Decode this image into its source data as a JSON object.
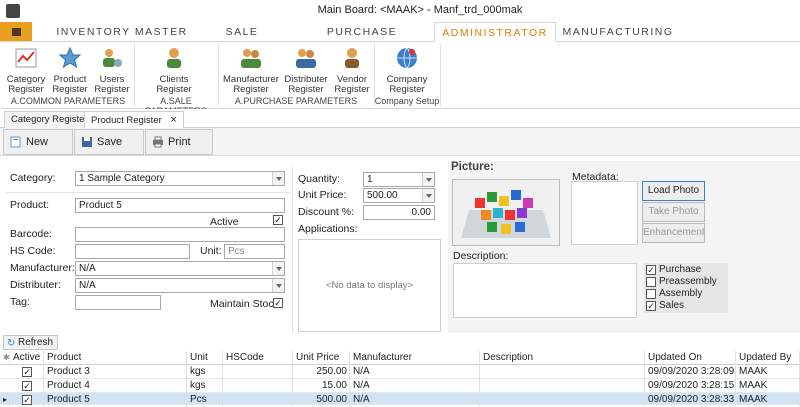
{
  "window": {
    "title": "Main Board: <MAAK> - Manf_trd_000mak"
  },
  "ribbon": {
    "tabs": [
      "INVENTORY MASTER",
      "SALE REGISTER",
      "PURCHASE REGISTER",
      "ADMINISTRATOR",
      "MANUFACTURING"
    ],
    "active_tab": "ADMINISTRATOR",
    "groups": [
      {
        "label": "A.COMMON PARAMETERS",
        "buttons": [
          {
            "line1": "Category",
            "line2": "Register",
            "icon": "chart-icon"
          },
          {
            "line1": "Product",
            "line2": "Register",
            "icon": "star-icon"
          },
          {
            "line1": "Users",
            "line2": "Register",
            "icon": "users-gear-icon"
          }
        ]
      },
      {
        "label": "A.SALE PARAMETERS",
        "buttons": [
          {
            "line1": "Clients",
            "line2": "Register",
            "icon": "person-icon"
          }
        ]
      },
      {
        "label": "A.PURCHASE PARAMETERS",
        "buttons": [
          {
            "line1": "Manufacturer",
            "line2": "Register",
            "icon": "people-icon"
          },
          {
            "line1": "Distributer",
            "line2": "Register",
            "icon": "people-icon"
          },
          {
            "line1": "Vendor",
            "line2": "Register",
            "icon": "person-icon"
          }
        ]
      },
      {
        "label": "Company Setup",
        "buttons": [
          {
            "line1": "Company",
            "line2": "Register",
            "icon": "globe-icon"
          }
        ]
      }
    ]
  },
  "doc_tabs": [
    {
      "label": "Category Register"
    },
    {
      "label": "Product Register",
      "close": "×"
    }
  ],
  "toolbar": {
    "new_label": "New",
    "save_label": "Save",
    "print_label": "Print"
  },
  "form": {
    "category_label": "Category:",
    "category_value": "1 Sample Category",
    "product_label": "Product:",
    "product_value": "Product 5",
    "active_label": "Active",
    "active_checked": "✓",
    "barcode_label": "Barcode:",
    "barcode_value": "",
    "hscode_label": "HS Code:",
    "hscode_value": "",
    "unit_label": "Unit:",
    "unit_placeholder": "Pcs",
    "manufacturer_label": "Manufacturer:",
    "manufacturer_value": "N/A",
    "distributer_label": "Distributer:",
    "distributer_value": "N/A",
    "tag_label": "Tag:",
    "tag_value": "",
    "maintain_stock_label": "Maintain Stock",
    "maintain_stock_checked": "✓",
    "quantity_label": "Quantity:",
    "quantity_value": "1",
    "unit_price_label": "Unit Price:",
    "unit_price_value": "500.00",
    "discount_label": "Discount %:",
    "discount_value": "0.00",
    "applications_label": "Applications:",
    "applications_empty": "<No data to display>",
    "picture_label": "Picture:",
    "metadata_label": "Metadata:",
    "description_label": "Description:",
    "load_photo": "Load Photo",
    "take_photo": "Take Photo",
    "enhancement": "Enhancement",
    "flags": [
      {
        "label": "Purchase",
        "checked": "✓"
      },
      {
        "label": "Preassembly",
        "checked": ""
      },
      {
        "label": "Assembly",
        "checked": ""
      },
      {
        "label": "Sales",
        "checked": "✓"
      }
    ]
  },
  "grid": {
    "refresh_label": "Refresh",
    "columns": [
      "Active",
      "Product",
      "Unit",
      "HSCode",
      "Unit Price",
      "Manufacturer",
      "Description",
      "Updated On",
      "Updated By"
    ],
    "rows": [
      {
        "active": "✓",
        "product": "Product 3",
        "unit": "kgs",
        "hscode": "",
        "unit_price": "250.00",
        "manufacturer": "N/A",
        "description": "",
        "updated_on": "09/09/2020 3:28:09 AM",
        "updated_by": "MAAK"
      },
      {
        "active": "✓",
        "product": "Product 4",
        "unit": "kgs",
        "hscode": "",
        "unit_price": "15.00",
        "manufacturer": "N/A",
        "description": "",
        "updated_on": "09/09/2020 3:28:15 AM",
        "updated_by": "MAAK"
      },
      {
        "active": "✓",
        "product": "Product 5",
        "unit": "Pcs",
        "hscode": "",
        "unit_price": "500.00",
        "manufacturer": "N/A",
        "description": "",
        "updated_on": "09/09/2020 3:28:33 AM",
        "updated_by": "MAAK"
      }
    ]
  }
}
